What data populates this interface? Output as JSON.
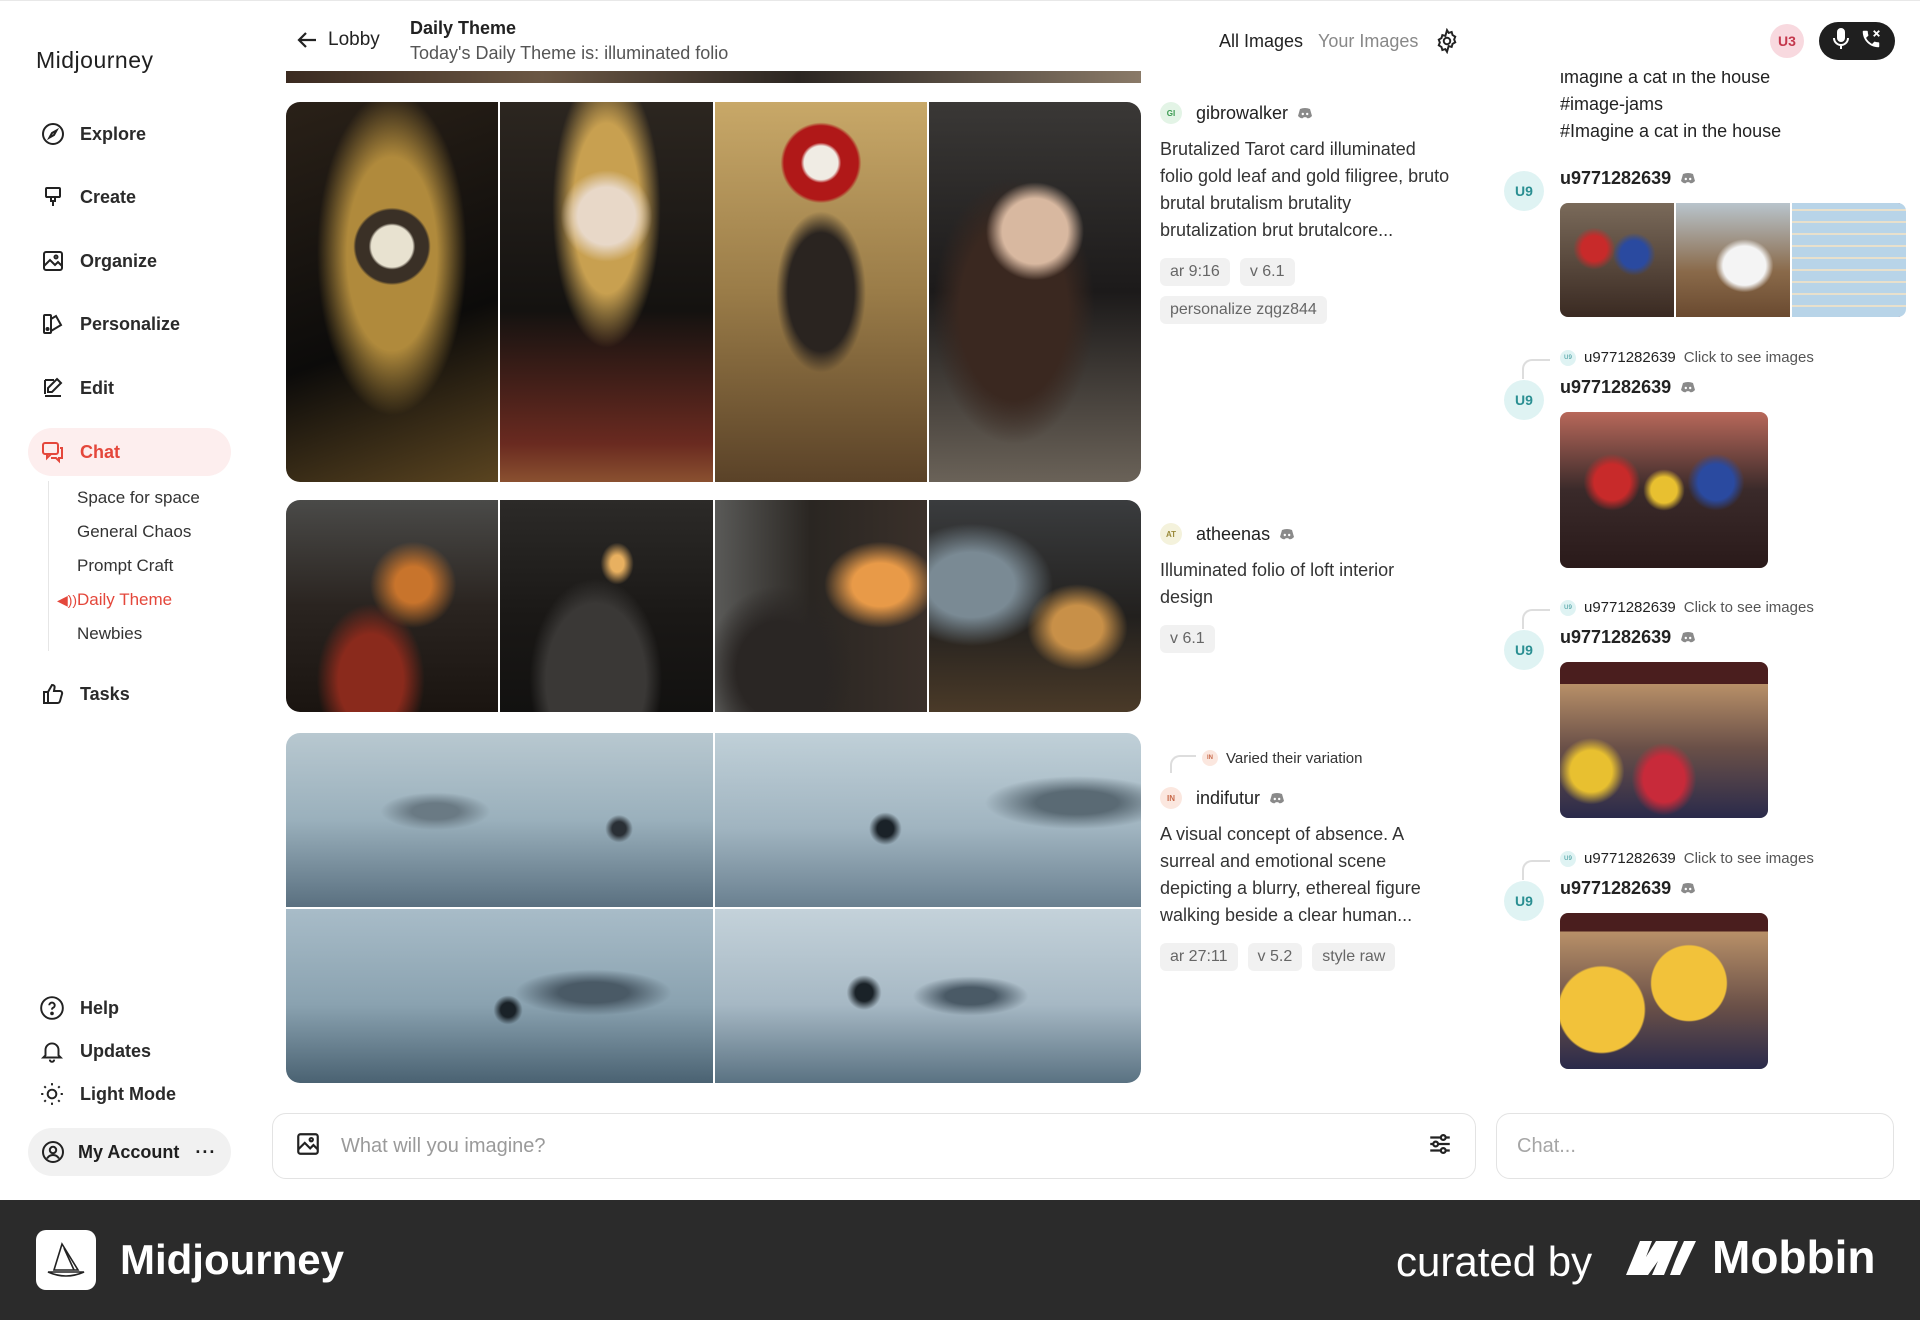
{
  "brand": "Midjourney",
  "nav": {
    "explore": "Explore",
    "create": "Create",
    "organize": "Organize",
    "personalize": "Personalize",
    "edit": "Edit",
    "chat": "Chat",
    "tasks": "Tasks"
  },
  "chat_rooms": [
    "Space for space",
    "General Chaos",
    "Prompt Craft",
    "Daily Theme",
    "Newbies"
  ],
  "bottom_nav": {
    "help": "Help",
    "updates": "Updates",
    "light_mode": "Light Mode",
    "account": "My Account",
    "more": "···"
  },
  "header": {
    "back_label": "Lobby",
    "title": "Daily Theme",
    "subtitle": "Today's Daily Theme is: illuminated folio",
    "filter_all": "All Images",
    "filter_yours": "Your Images",
    "user_badge": "U3"
  },
  "posts": [
    {
      "avatar": "GI",
      "avatar_color": "#e3f4e6",
      "username": "gibrowalker",
      "prompt": "Brutalized Tarot card illuminated folio gold leaf and gold filigree, bruto brutal brutalism brutality brutalization brut brutalcore...",
      "tags": [
        "ar 9:16",
        "v 6.1",
        "personalize zqgz844"
      ]
    },
    {
      "avatar": "AT",
      "avatar_color": "#f4f2dc",
      "username": "atheenas",
      "prompt": "Illuminated folio of loft interior design",
      "tags": [
        "v 6.1"
      ]
    },
    {
      "avatar": "IN",
      "avatar_color": "#fbe7df",
      "username": "indifutur",
      "varied_label": "Varied their variation",
      "prompt": "A visual concept of absence. A surreal and emotional scene depicting a blurry, ethereal figure walking beside a clear human...",
      "tags": [
        "ar 27:11",
        "v 5.2",
        "style raw"
      ]
    }
  ],
  "chat": {
    "top_lines": [
      "imagine a cat in the house",
      "#image-jams",
      "#Imagine a cat in the house"
    ],
    "avatar": "U9",
    "username": "u9771282639",
    "reply_hint": "Click to see images"
  },
  "inputs": {
    "imagine_placeholder": "What will you imagine?",
    "chat_placeholder": "Chat..."
  },
  "footer": {
    "app_name": "Midjourney",
    "curated_by": "curated by",
    "mobbin": "Mobbin"
  },
  "colors": {
    "accent": "#e4473b",
    "active_bg": "#fdeeee",
    "footer_bg": "#2b2b2b"
  }
}
